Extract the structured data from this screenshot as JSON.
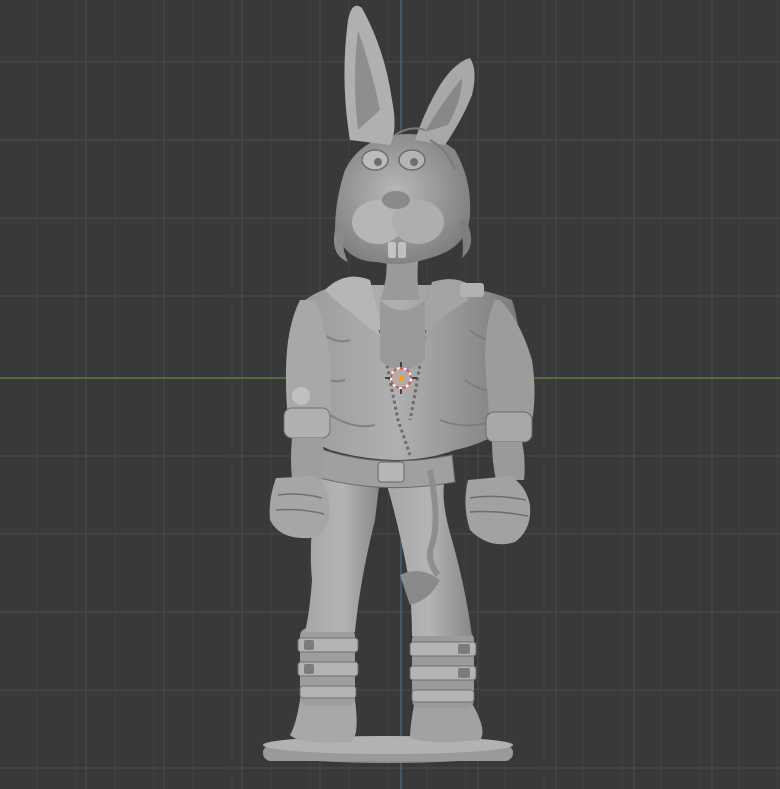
{
  "viewport": {
    "background": "#393939",
    "grid_minor_color": "#414141",
    "grid_major_color": "#4a4a4a",
    "axis_x_color": "#6a9a4a",
    "axis_z_color": "#4a6a9a",
    "model_color": "#8c8c8c",
    "model_shadow_color": "#6a6a6a",
    "model_highlight_color": "#b8b8b8"
  },
  "scene": {
    "object": "rabbit-figurine-sculpt",
    "origin_marker": "3d-cursor-icon"
  }
}
